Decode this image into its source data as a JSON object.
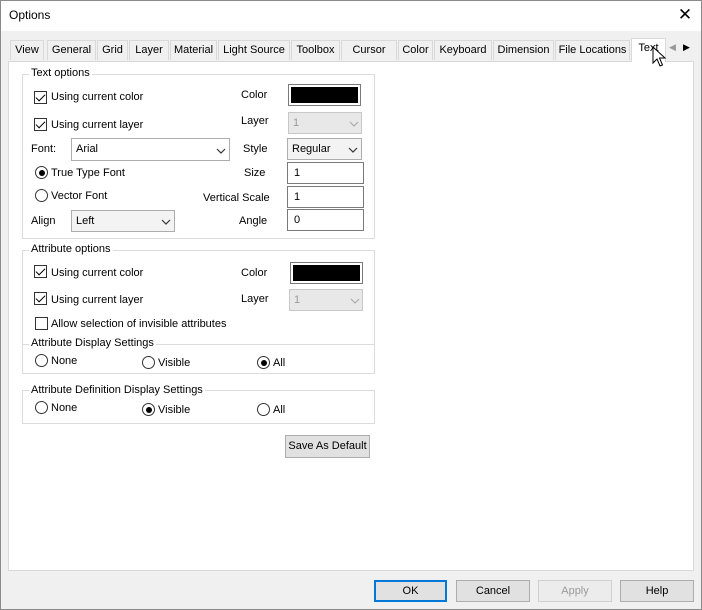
{
  "window": {
    "title": "Options",
    "close_glyph": "✕"
  },
  "tabs": [
    "View",
    "General",
    "Grid",
    "Layer",
    "Material",
    "Light Source",
    "Toolbox",
    "Cursor",
    "Color",
    "Keyboard",
    "Dimension",
    "File Locations",
    "Text"
  ],
  "active_tab": "Text",
  "text_options": {
    "group_label": "Text options",
    "use_current_color": "Using current color",
    "use_current_layer": "Using current layer",
    "color_label": "Color",
    "layer_label": "Layer",
    "layer_value": "1",
    "font_label": "Font:",
    "font_value": "Arial",
    "style_label": "Style",
    "style_value": "Regular",
    "true_type": "True Type Font",
    "vector_font": "Vector Font",
    "size_label": "Size",
    "size_value": "1",
    "vscale_label": "Vertical Scale",
    "vscale_value": "1",
    "align_label": "Align",
    "align_value": "Left",
    "angle_label": "Angle",
    "angle_value": "0",
    "color_swatch": "#000000"
  },
  "attribute_options": {
    "group_label": "Attribute options",
    "use_current_color": "Using current color",
    "use_current_layer": "Using current layer",
    "color_label": "Color",
    "layer_label": "Layer",
    "layer_value": "1",
    "allow_invisible": "Allow selection of invisible attributes",
    "display_settings_label": "Attribute Display Settings",
    "none": "None",
    "visible": "Visible",
    "all": "All",
    "color_swatch": "#000000"
  },
  "attribute_definition": {
    "group_label": "Attribute Definition Display Settings",
    "none": "None",
    "visible": "Visible",
    "all": "All"
  },
  "save_default": "Save As Default",
  "footer": {
    "ok": "OK",
    "cancel": "Cancel",
    "apply": "Apply",
    "help": "Help"
  }
}
